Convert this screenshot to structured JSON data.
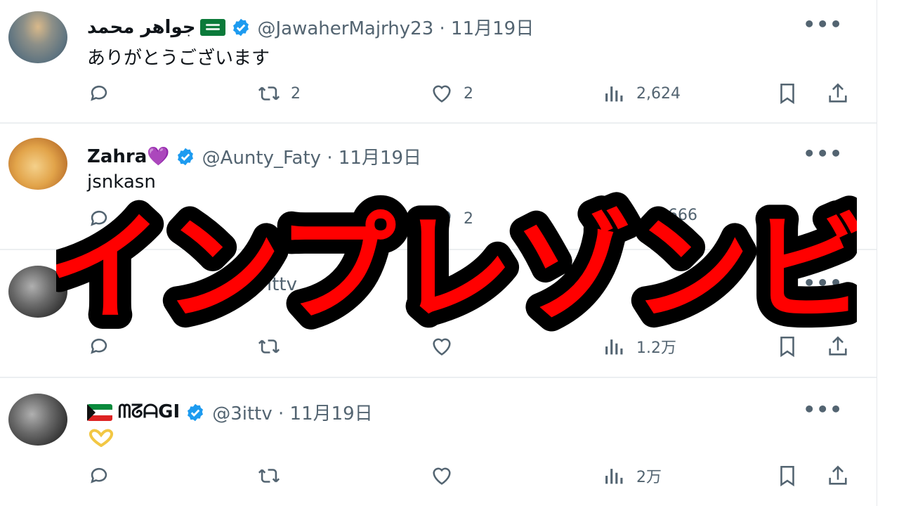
{
  "tweets": [
    {
      "name": "جواهر محمد",
      "handle": "@JawaherMajrhy23 · 11月19日",
      "text": "ありがとうございます",
      "replies": "",
      "retweets": "2",
      "likes": "2",
      "views": "2,624"
    },
    {
      "name": "Zahra",
      "handle": "@Aunty_Faty · 11月19日",
      "text": "jsnkasn",
      "replies": "",
      "retweets": "",
      "likes": "2",
      "views": "2,666"
    },
    {
      "name": "",
      "handle": "ittv",
      "text": "",
      "replies": "",
      "retweets": "",
      "likes": "",
      "views": "1.2万"
    },
    {
      "name": "ᗰᘔᗩGI",
      "handle": "@3ittv · 11月19日",
      "text": "",
      "replies": "",
      "retweets": "",
      "likes": "",
      "views": "2万"
    }
  ],
  "overlay": {
    "text": "インプレゾンビ",
    "fill": "#ff0000",
    "stroke": "#000000"
  },
  "colors": {
    "verified": "#1d9bf0",
    "muted": "#536471"
  }
}
